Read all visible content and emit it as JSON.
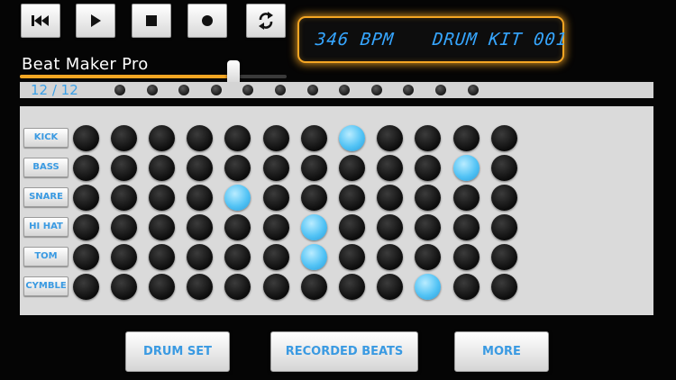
{
  "app": {
    "title": "Beat Maker Pro"
  },
  "transport": {
    "buttons": [
      {
        "name": "rewind-button",
        "icon": "skip-back-icon"
      },
      {
        "name": "play-button",
        "icon": "play-icon"
      },
      {
        "name": "stop-button",
        "icon": "stop-icon"
      },
      {
        "name": "record-button",
        "icon": "record-icon"
      },
      {
        "name": "loop-button",
        "icon": "sync-icon"
      }
    ]
  },
  "display": {
    "tempo": "346 BPM",
    "kit": "DRUM KIT 001"
  },
  "tempo_slider": {
    "value": 0.8
  },
  "steps": {
    "counter": "12 / 12",
    "count": 12
  },
  "instruments": [
    {
      "label": "KICK",
      "pattern": [
        0,
        0,
        0,
        0,
        0,
        0,
        0,
        1,
        0,
        0,
        0,
        0
      ]
    },
    {
      "label": "BASS",
      "pattern": [
        0,
        0,
        0,
        0,
        0,
        0,
        0,
        0,
        0,
        0,
        1,
        0
      ]
    },
    {
      "label": "SNARE",
      "pattern": [
        0,
        0,
        0,
        0,
        1,
        0,
        0,
        0,
        0,
        0,
        0,
        0
      ]
    },
    {
      "label": "HI HAT",
      "pattern": [
        0,
        0,
        0,
        0,
        0,
        0,
        1,
        0,
        0,
        0,
        0,
        0
      ]
    },
    {
      "label": "TOM",
      "pattern": [
        0,
        0,
        0,
        0,
        0,
        0,
        1,
        0,
        0,
        0,
        0,
        0
      ]
    },
    {
      "label": "CYMBLE",
      "pattern": [
        0,
        0,
        0,
        0,
        0,
        0,
        0,
        0,
        0,
        1,
        0,
        0
      ]
    }
  ],
  "bottom_nav": {
    "drum_set": "DRUM SET",
    "recorded_beats": "RECORDED BEATS",
    "more": "MORE"
  },
  "colors": {
    "accent": "#f5a623",
    "lcd_text": "#36a6ff",
    "pad_on": "#52c3f5",
    "label_text": "#3a9ae2"
  }
}
